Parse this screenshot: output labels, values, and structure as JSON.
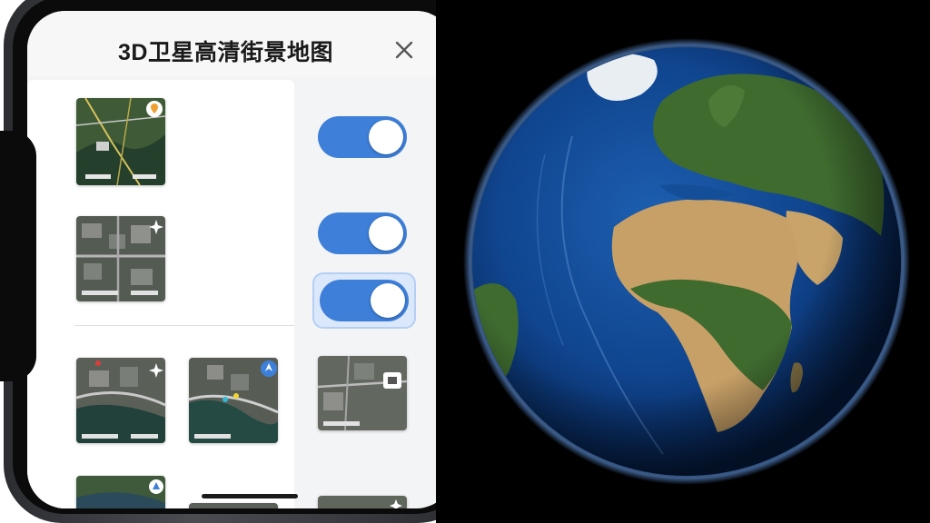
{
  "app": {
    "title": "3D卫星高清街景地图"
  },
  "icons": {
    "close": "close-icon",
    "pin": "location-pin-icon",
    "compass": "compass-icon",
    "navigate": "navigation-arrow-icon",
    "globe": "earth-globe"
  },
  "toggles": [
    {
      "state": "on"
    },
    {
      "state": "on"
    },
    {
      "state": "on",
      "focused": true
    }
  ],
  "colors": {
    "accent": "#3d7fd9",
    "screen_bg": "#f3f4f6",
    "ocean": "#0e3f85",
    "land_green": "#3f6b2f",
    "desert": "#c9a46a"
  }
}
